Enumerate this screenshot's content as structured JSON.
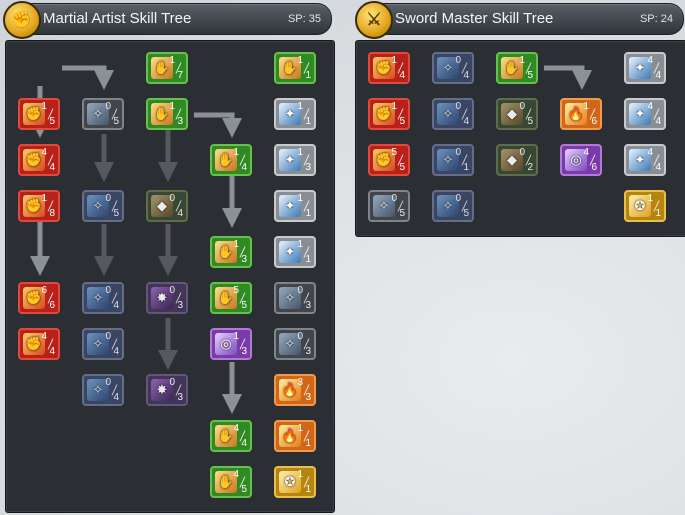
{
  "martial_artist": {
    "title": "Martial Artist Skill Tree",
    "sp": "SP: 35",
    "emblem_icon": "fist-icon",
    "skills": [
      {
        "id": "ma-r1c1",
        "cur": "1",
        "max": "5",
        "color": "red",
        "icon": "palm-strike-icon"
      },
      {
        "id": "ma-r2c1",
        "cur": "4",
        "max": "4",
        "color": "red",
        "icon": "flying-kick-icon"
      },
      {
        "id": "ma-r3c1",
        "cur": "1",
        "max": "8",
        "color": "red",
        "icon": "combo-punch-icon"
      },
      {
        "id": "ma-r5c1",
        "cur": "6",
        "max": "6",
        "color": "red",
        "icon": "grab-icon"
      },
      {
        "id": "ma-r6c1",
        "cur": "4",
        "max": "4",
        "color": "red",
        "icon": "rage-face-icon"
      },
      {
        "id": "ma-r1c2",
        "cur": "0",
        "max": "5",
        "color": "locked-grey",
        "icon": "blade-wave-icon"
      },
      {
        "id": "ma-r3c2",
        "cur": "0",
        "max": "5",
        "color": "locked",
        "icon": "wind-icon"
      },
      {
        "id": "ma-r5c2",
        "cur": "0",
        "max": "4",
        "color": "locked",
        "icon": "burst-icon"
      },
      {
        "id": "ma-r6c2",
        "cur": "0",
        "max": "4",
        "color": "locked",
        "icon": "star-aura-icon"
      },
      {
        "id": "ma-r7c2",
        "cur": "0",
        "max": "4",
        "color": "locked",
        "icon": "sparkle-icon"
      },
      {
        "id": "ma-r0c3",
        "cur": "1",
        "max": "7",
        "color": "green",
        "icon": "fist-icon"
      },
      {
        "id": "ma-r1c3",
        "cur": "1",
        "max": "3",
        "color": "green",
        "icon": "lion-face-icon"
      },
      {
        "id": "ma-r3c3",
        "cur": "0",
        "max": "4",
        "color": "locked-green",
        "icon": "uppercut-icon"
      },
      {
        "id": "ma-r5c3",
        "cur": "0",
        "max": "3",
        "color": "locked-purple",
        "icon": "shadow-icon"
      },
      {
        "id": "ma-r7c3",
        "cur": "0",
        "max": "3",
        "color": "locked-purple",
        "icon": "vortex-icon"
      },
      {
        "id": "ma-r2c4",
        "cur": "1",
        "max": "4",
        "color": "green",
        "icon": "heavy-blow-icon"
      },
      {
        "id": "ma-r4c4",
        "cur": "1",
        "max": "3",
        "color": "green",
        "icon": "explosion-icon"
      },
      {
        "id": "ma-r5c4",
        "cur": "5",
        "max": "5",
        "color": "green",
        "icon": "monk-icon"
      },
      {
        "id": "ma-r6c4",
        "cur": "1",
        "max": "3",
        "color": "purple",
        "icon": "ring-icon"
      },
      {
        "id": "ma-r8c4",
        "cur": "4",
        "max": "4",
        "color": "green",
        "icon": "star-burst-icon"
      },
      {
        "id": "ma-r9c4",
        "cur": "4",
        "max": "5",
        "color": "green",
        "icon": "crescent-icon"
      },
      {
        "id": "ma-r0c5",
        "cur": "1",
        "max": "1",
        "color": "green",
        "icon": "spirit-face-icon"
      },
      {
        "id": "ma-r1c5",
        "cur": "1",
        "max": "1",
        "color": "grey",
        "icon": "glow-hand-icon"
      },
      {
        "id": "ma-r2c5",
        "cur": "1",
        "max": "3",
        "color": "grey",
        "icon": "shield-icon"
      },
      {
        "id": "ma-r3c5",
        "cur": "1",
        "max": "1",
        "color": "grey",
        "icon": "stance-icon"
      },
      {
        "id": "ma-r4c5",
        "cur": "1",
        "max": "1",
        "color": "grey",
        "icon": "dash-icon"
      },
      {
        "id": "ma-r5c5",
        "cur": "0",
        "max": "3",
        "color": "locked-grey",
        "icon": "gear-aura-icon"
      },
      {
        "id": "ma-r6c5",
        "cur": "0",
        "max": "3",
        "color": "locked-grey",
        "icon": "meditate-icon"
      },
      {
        "id": "ma-r7c5",
        "cur": "3",
        "max": "3",
        "color": "orange",
        "icon": "rush-icon"
      },
      {
        "id": "ma-r8c5",
        "cur": "1",
        "max": "1",
        "color": "orange",
        "icon": "fire-hand-icon"
      },
      {
        "id": "ma-r9c5",
        "cur": "1",
        "max": "1",
        "color": "gold",
        "icon": "spiral-icon"
      }
    ]
  },
  "sword_master": {
    "title": "Sword Master Skill Tree",
    "sp": "SP: 24",
    "emblem_icon": "crossed-swords-icon",
    "skills": [
      {
        "id": "sm-r0c1",
        "cur": "1",
        "max": "4",
        "color": "red",
        "icon": "slash-icon"
      },
      {
        "id": "sm-r1c1",
        "cur": "1",
        "max": "5",
        "color": "red",
        "icon": "z-slash-icon"
      },
      {
        "id": "sm-r2c1",
        "cur": "5",
        "max": "5",
        "color": "red",
        "icon": "triple-slash-icon"
      },
      {
        "id": "sm-r3c1",
        "cur": "0",
        "max": "5",
        "color": "locked-grey",
        "icon": "thrust-icon"
      },
      {
        "id": "sm-r0c2",
        "cur": "0",
        "max": "4",
        "color": "locked",
        "icon": "swordsman-icon"
      },
      {
        "id": "sm-r1c2",
        "cur": "0",
        "max": "4",
        "color": "locked",
        "icon": "blade-wave-icon"
      },
      {
        "id": "sm-r2c2",
        "cur": "0",
        "max": "1",
        "color": "locked",
        "icon": "cross-slash-icon"
      },
      {
        "id": "sm-r3c2",
        "cur": "0",
        "max": "5",
        "color": "locked",
        "icon": "wind-slash-icon"
      },
      {
        "id": "sm-r0c3",
        "cur": "1",
        "max": "5",
        "color": "green",
        "icon": "flame-warrior-icon"
      },
      {
        "id": "sm-r1c3",
        "cur": "0",
        "max": "5",
        "color": "locked-green",
        "icon": "impact-icon"
      },
      {
        "id": "sm-r2c3",
        "cur": "0",
        "max": "2",
        "color": "locked-green",
        "icon": "swirl-icon"
      },
      {
        "id": "sm-r1c4",
        "cur": "1",
        "max": "6",
        "color": "orange",
        "icon": "fury-icon"
      },
      {
        "id": "sm-r2c4",
        "cur": "4",
        "max": "6",
        "color": "purple",
        "icon": "crystal-icon"
      },
      {
        "id": "sm-r0c5",
        "cur": "4",
        "max": "4",
        "color": "grey",
        "icon": "sword-icon"
      },
      {
        "id": "sm-r1c5",
        "cur": "4",
        "max": "4",
        "color": "grey",
        "icon": "parry-icon"
      },
      {
        "id": "sm-r2c5",
        "cur": "4",
        "max": "4",
        "color": "grey",
        "icon": "light-blade-icon"
      },
      {
        "id": "sm-r3c5",
        "cur": "1",
        "max": "1",
        "color": "gold",
        "icon": "golden-strike-icon"
      }
    ]
  }
}
